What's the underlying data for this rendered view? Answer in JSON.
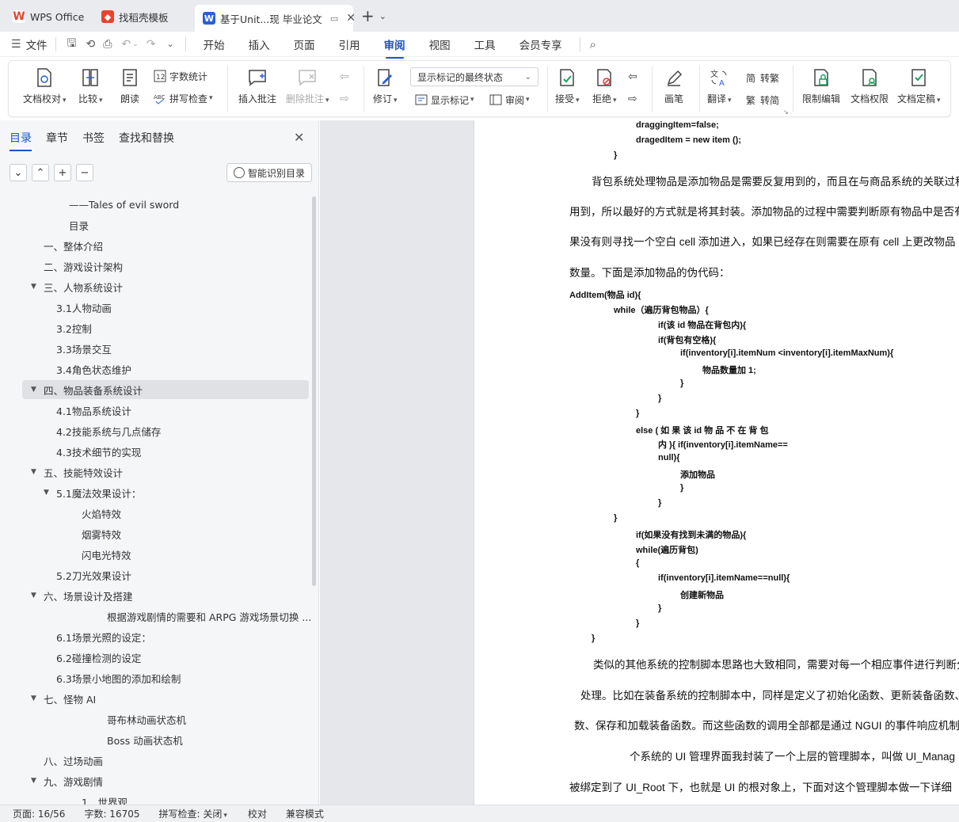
{
  "tabs": [
    {
      "label": "WPS Office",
      "icon": "wps-logo-icon",
      "color": "#e8432e"
    },
    {
      "label": "找稻壳模板",
      "icon": "docer-logo-icon",
      "color": "#e8432e"
    },
    {
      "label": "基于Unit...现 毕业论文",
      "icon": "word-doc-icon",
      "color": "#2b5fd9"
    }
  ],
  "new_tab": {
    "plus": "+",
    "more": "⌄"
  },
  "menu": {
    "file": "文件",
    "items": [
      "开始",
      "插入",
      "页面",
      "引用",
      "审阅",
      "视图",
      "工具",
      "会员专享"
    ],
    "active": "审阅"
  },
  "ribbon": {
    "proofread": "文档校对",
    "compare": "比较",
    "read_aloud": "朗读",
    "word_count": "字数统计",
    "spell_check": "拼写检查",
    "insert_comment": "插入批注",
    "delete_comment": "删除批注",
    "track_changes": "修订",
    "markup_state": "显示标记的最终状态",
    "show_markup": "显示标记",
    "review_pane": "审阅",
    "accept": "接受",
    "reject": "拒绝",
    "pen": "画笔",
    "translate": "翻译",
    "to_traditional": "转繁",
    "to_simplified": "转简",
    "restrict_edit": "限制编辑",
    "doc_permission": "文档权限",
    "finalize": "文档定稿"
  },
  "nav": {
    "tabs": [
      "目录",
      "章节",
      "书签",
      "查找和替换"
    ],
    "smart_toc": "智能识别目录",
    "toc": [
      {
        "text": "——Tales of evil sword",
        "level": 4
      },
      {
        "text": "目录",
        "level": 4
      },
      {
        "text": "一、整体介绍",
        "level": 1
      },
      {
        "text": "二、游戏设计架构",
        "level": 1
      },
      {
        "text": "三、人物系统设计",
        "level": 1,
        "expanded": true
      },
      {
        "text": "3.1人物动画",
        "level": 2
      },
      {
        "text": "3.2控制",
        "level": 2
      },
      {
        "text": "3.3场景交互",
        "level": 2
      },
      {
        "text": "3.4角色状态维护",
        "level": 2
      },
      {
        "text": "四、物品装备系统设计",
        "level": 1,
        "expanded": true,
        "selected": true
      },
      {
        "text": "4.1物品系统设计",
        "level": 2
      },
      {
        "text": "4.2技能系统与几点储存",
        "level": 2
      },
      {
        "text": "4.3技术细节的实现",
        "level": 2
      },
      {
        "text": "五、技能特效设计",
        "level": 1,
        "expanded": true
      },
      {
        "text": "5.1魔法效果设计：",
        "level": 2,
        "expanded": true
      },
      {
        "text": "火焰特效",
        "level": 3
      },
      {
        "text": "烟雾特效",
        "level": 3
      },
      {
        "text": "闪电光特效",
        "level": 3
      },
      {
        "text": "5.2刀光效果设计",
        "level": 2
      },
      {
        "text": "六、场景设计及搭建",
        "level": 1,
        "expanded": true
      },
      {
        "text": "根据游戏剧情的需要和 ARPG 游戏场景切换 ...",
        "level": 4
      },
      {
        "text": "6.1场景光照的设定：",
        "level": 2
      },
      {
        "text": "6.2碰撞检测的设定",
        "level": 2
      },
      {
        "text": "6.3场景小地图的添加和绘制",
        "level": 2
      },
      {
        "text": "七、怪物 AI",
        "level": 1,
        "expanded": true
      },
      {
        "text": "哥布林动画状态机",
        "level": 4
      },
      {
        "text": "Boss 动画状态机",
        "level": 4
      },
      {
        "text": "八、过场动画",
        "level": 1
      },
      {
        "text": "九、游戏剧情",
        "level": 1,
        "expanded": true
      },
      {
        "text": "1．世界观",
        "level": 3
      }
    ]
  },
  "document": {
    "lines": [
      "draggingItem=false;",
      "dragedItem = new item ();",
      "}",
      "背包系统处理物品是添加物品是需要反复用到的，而且在与商品系统的关联过程",
      "用到，所以最好的方式就是将其封装。添加物品的过程中需要判断原有物品中是否有",
      "果没有则寻找一个空白 cell 添加进入，如果已经存在则需要在原有 cell 上更改物品",
      "数量。下面是添加物品的伪代码：",
      "AddItem(物品 id){",
      "while（遍历背包物品）{",
      "if(该 id 物品在背包内){",
      "if(背包有空格){",
      "if(inventory[i].itemNum <inventory[i].itemMaxNum){",
      "物品数量加 1;",
      "}",
      "}",
      "}",
      "else ( 如 果 该 id 物 品 不 在 背 包",
      "内 ){ if(inventory[i].itemName==",
      "null){",
      "添加物品",
      "}",
      "}",
      "}",
      "if(如果没有找到未满的物品){",
      "while(遍历背包)",
      "{",
      "if(inventory[i].itemName==null){",
      "创建新物品",
      "}",
      "}",
      "}",
      "类似的其他系统的控制脚本思路也大致相同，需要对每一个相应事件进行判断分",
      "处理。比如在装备系统的控制脚本中，同样是定义了初始化函数、更新装备函数、显",
      "数、保存和加载装备函数。而这些函数的调用全部都是通过 NGUI 的事件响应机制",
      "个系统的 UI 管理界面我封装了一个上层的管理脚本，叫做 UI_Manag",
      "被绑定到了 UI_Root 下，也就是 UI 的根对象上，下面对这个管理脚本做一下详细"
    ]
  },
  "status": {
    "page": "页面: 16/56",
    "words": "字数: 16705",
    "spell": "拼写检查: 关闭",
    "proof": "校对",
    "compat": "兼容模式"
  }
}
